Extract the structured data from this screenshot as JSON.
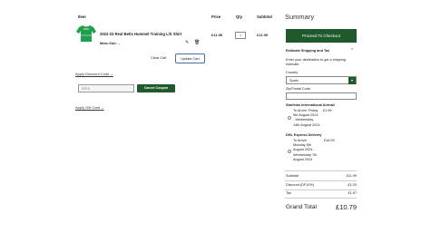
{
  "cart": {
    "headers": {
      "item": "Item",
      "price": "Price",
      "qty": "Qty",
      "subtotal": "Subtotal"
    },
    "item": {
      "name": "2022-23 Real Betis Hummel Training L/S Shirt",
      "option_label": "Menu Size:",
      "price": "£11.99",
      "qty": "1",
      "subtotal": "£11.99",
      "image_icon": "green-shirt-icon"
    },
    "clear_label": "Clear Cart",
    "update_label": "Update Cart"
  },
  "discount": {
    "link_label": "Apply Discount Code",
    "code_value": "DF10",
    "cancel_label": "Cancel Coupon"
  },
  "gift": {
    "link_label": "Apply Gift Card"
  },
  "summary": {
    "title": "Summary",
    "checkout_label": "Proceed To Checkout",
    "estimate_label": "Estimate Shipping and Tax",
    "estimate_desc": "Enter your destination to get a shipping estimate.",
    "country_label": "Country",
    "country_value": "Spain",
    "zip_label": "Zip/Postal Code",
    "shipping": [
      {
        "carrier": "Starlinks International Airmail",
        "lines": [
          "To Arrive: Friday",
          "9th August 2024",
          "- Wednesday",
          "14th August 2024"
        ],
        "price": "£1.99"
      },
      {
        "carrier": "DHL Express Delivery",
        "lines": [
          "To Arrive:",
          "Monday 5th",
          "August 2024 -",
          "Wednesday 7th",
          "August 2024"
        ],
        "price": "£16.99"
      }
    ],
    "totals": [
      {
        "label": "Subtotal",
        "value": "£11.99"
      },
      {
        "label": "Discount (DF10%)",
        "value": "-£1.20"
      },
      {
        "label": "Tax",
        "value": "£1.97"
      }
    ],
    "grand_label": "Grand Total",
    "grand_value": "£10.79"
  },
  "colors": {
    "accent": "#1e5a2c",
    "shirt": "#1fa04e"
  }
}
